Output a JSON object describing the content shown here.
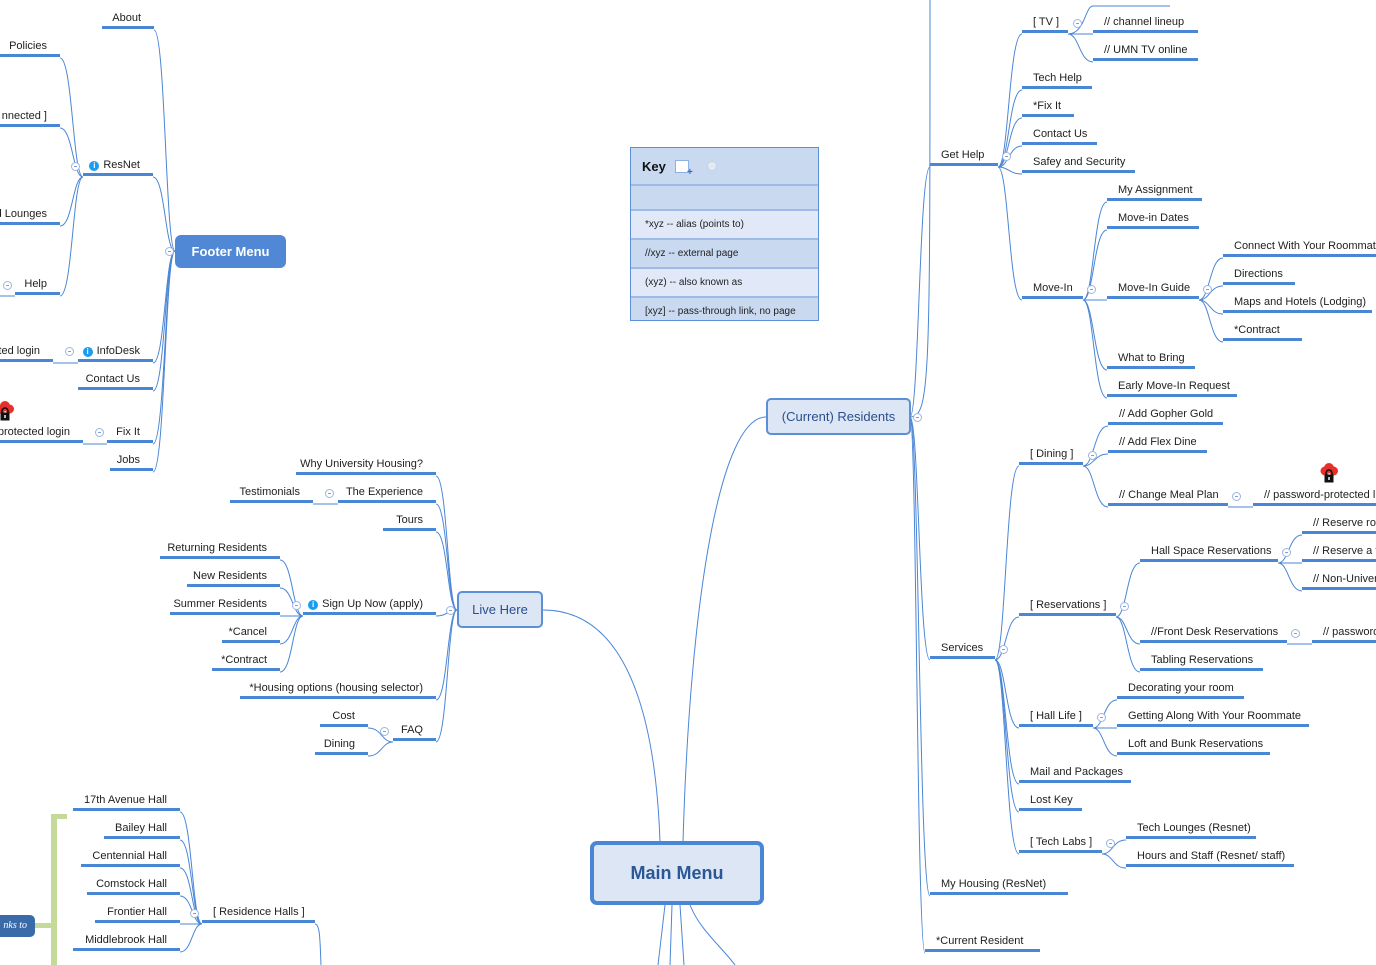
{
  "colors": {
    "branch": "#4a86d6",
    "footer_fill": "#5088d6",
    "topic_fill": "#dce6f5",
    "info": "#1a9cf0",
    "lock": "#e8302a",
    "bracket": "#c5d99a"
  },
  "key": {
    "title": "Key",
    "rows": [
      "*xyz -- alias (points to)",
      "//xyz  --  external page",
      "(xyz) -- also known as",
      "[xyz] -- pass-through link, no page"
    ]
  },
  "main_menu": {
    "title": "Main Menu"
  },
  "footer": {
    "title": "Footer Menu",
    "items": [
      "About",
      "Policies",
      "nnected ]",
      "d Lounges",
      "Help",
      "ResNet",
      "ted login",
      "InfoDesk",
      "Contact Us",
      "protected login",
      "Fix It",
      "Jobs"
    ]
  },
  "live": {
    "title": "Live Here",
    "items": [
      "Why University Housing?",
      "Testimonials",
      "The Experience",
      "Tours",
      "Returning Residents",
      "New Residents",
      "Summer Residents",
      "*Cancel",
      "*Contract",
      "Sign Up Now (apply)",
      "*Housing options (housing selector)",
      "Cost",
      "Dining",
      "FAQ"
    ]
  },
  "halls": {
    "items": [
      "17th Avenue Hall",
      "Bailey Hall",
      "Centennial Hall",
      "Comstock Hall",
      "Frontier Hall",
      "Middlebrook Hall",
      "[ Residence Halls ]"
    ],
    "badge": "nks to"
  },
  "residents": {
    "title": "(Current) Residents",
    "items": [
      "Get Help",
      "[ TV ]",
      "// channel lineup",
      "// UMN TV online",
      "Tech Help",
      "*Fix It",
      "Contact Us",
      "Safey and Security",
      "Move-In",
      "My Assignment",
      "Move-in Dates",
      "Move-In Guide",
      "Connect With Your Roommate",
      "Directions",
      "Maps and Hotels (Lodging)",
      "*Contract",
      "What to Bring",
      "Early Move-In Request",
      "Services",
      "[ Dining ]",
      "// Add Gopher Gold",
      "// Add Flex Dine",
      "// Change Meal Plan",
      "// password-protected l",
      "[ Reservations ]",
      "Hall Space Reservations",
      "// Reserve ro",
      "// Reserve a t",
      "// Non-Univer",
      "//Front Desk Reservations",
      "// password",
      "Tabling Reservations",
      "[ Hall Life ]",
      "Decorating your room",
      "Getting Along With Your Roommate",
      "Loft and Bunk Reservations",
      "Mail and Packages",
      "Lost Key",
      "[ Tech Labs ]",
      "Tech Lounges (Resnet)",
      "Hours and Staff (Resnet/ staff)",
      "My Housing (ResNet)",
      "*Current Resident"
    ]
  }
}
